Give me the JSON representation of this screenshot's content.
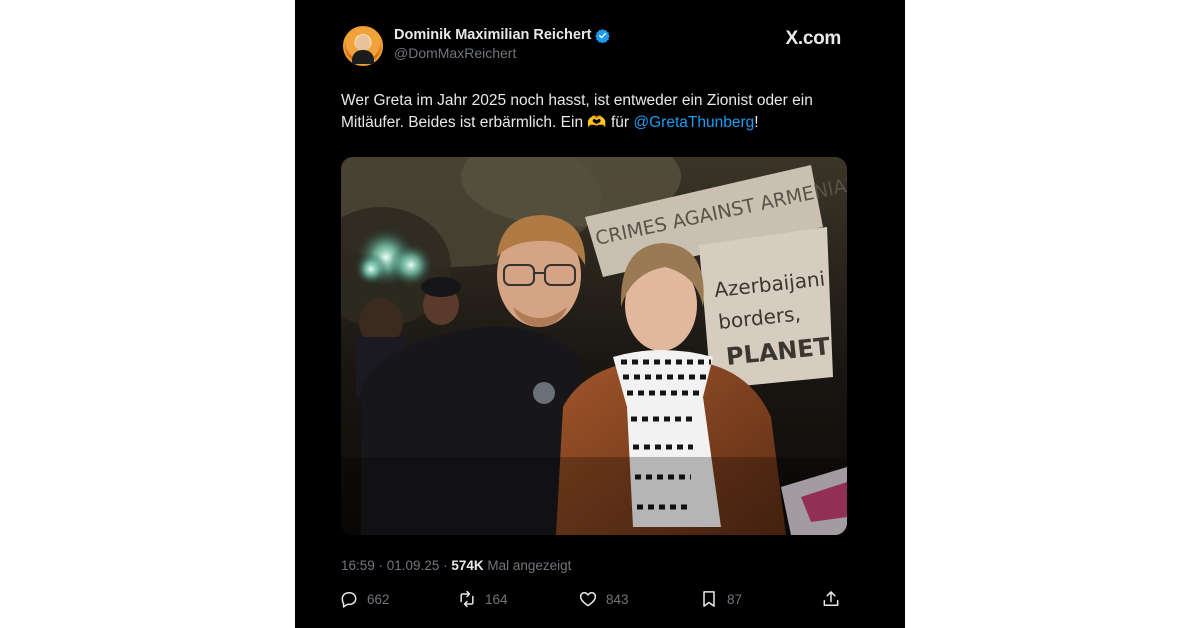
{
  "post": {
    "author_name": "Dominik Maximilian Reichert",
    "author_handle": "@DomMaxReichert",
    "site": "X.com",
    "text_before": "Wer Greta im Jahr 2025 noch hasst, ist entweder ein Zionist oder ein Mitläufer. Beides ist erbärmlich. Ein ",
    "emoji": "🫶",
    "text_mid": " für ",
    "mention": "@GretaThunberg",
    "text_after": "!",
    "timestamp": "16:59 · 01.09.25 · ",
    "views": "574K",
    "views_suffix": " Mal angezeigt"
  },
  "photo": {
    "sign_text_1": "CRIMES AGAINST ARMENIANS",
    "sign_text_2": "Azerbaijani",
    "sign_text_3": "borders,",
    "sign_text_4": "PLANET"
  },
  "actions": {
    "replies": "662",
    "reposts": "164",
    "likes": "843",
    "bookmarks": "87"
  },
  "colors": {
    "background": "#000000",
    "text": "#e7e9ea",
    "muted": "#71767b",
    "link": "#1d9bf0"
  }
}
